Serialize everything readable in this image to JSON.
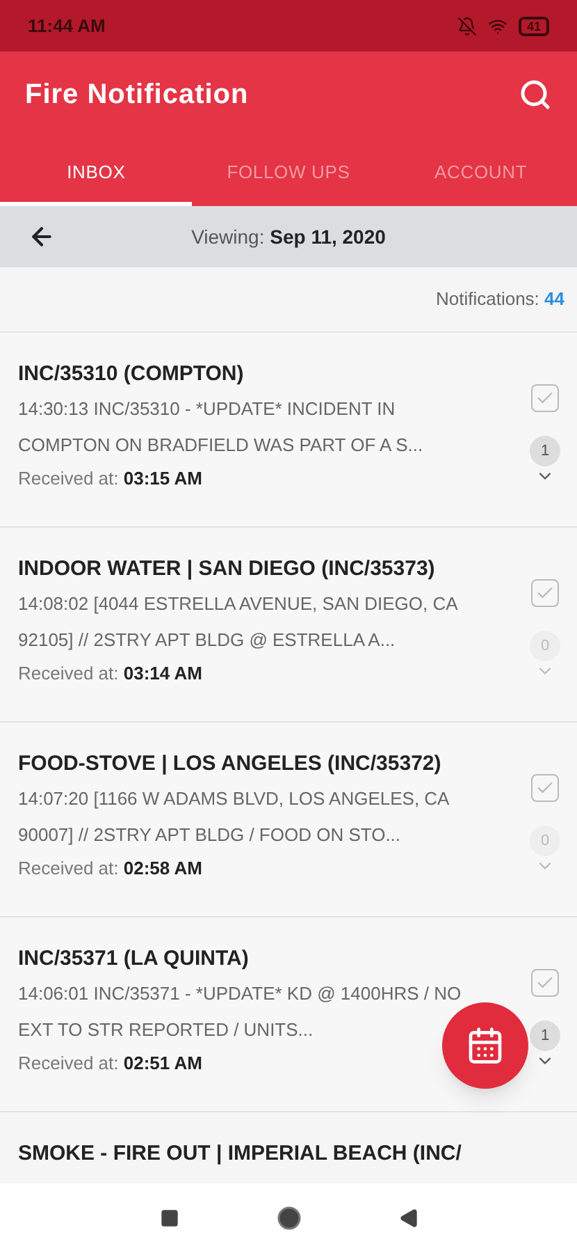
{
  "status_bar": {
    "time": "11:44 AM",
    "battery": "41"
  },
  "app_bar": {
    "title": "Fire Notification"
  },
  "tabs": [
    {
      "label": "INBOX",
      "selected": true
    },
    {
      "label": "FOLLOW UPS",
      "selected": false
    },
    {
      "label": "ACCOUNT",
      "selected": false
    }
  ],
  "date_bar": {
    "label": "Viewing:",
    "date": "Sep 11, 2020"
  },
  "summary": {
    "label": "Notifications:",
    "count": "44"
  },
  "notifications": [
    {
      "title": "INC/35310 (COMPTON)",
      "body": "14:30:13 INC/35310 - *UPDATE* INCIDENT IN COMPTON ON BRADFIELD WAS PART OF A S...",
      "received_label": "Received at:",
      "received_time": "03:15 AM",
      "count": "1",
      "checked": false
    },
    {
      "title": "INDOOR WATER | SAN DIEGO (INC/35373)",
      "body": "14:08:02 [4044 ESTRELLA AVENUE, SAN DIEGO, CA 92105]  // 2STRY APT BLDG @ ESTRELLA A...",
      "received_label": "Received at:",
      "received_time": "03:14 AM",
      "count": "0",
      "checked": false
    },
    {
      "title": "FOOD-STOVE | LOS ANGELES (INC/35372)",
      "body": "14:07:20 [1166 W ADAMS BLVD, LOS ANGELES, CA 90007]  // 2STRY APT BLDG / FOOD ON STO...",
      "received_label": "Received at:",
      "received_time": "02:58 AM",
      "count": "0",
      "checked": false
    },
    {
      "title": "INC/35371 (LA QUINTA)",
      "body": "14:06:01 INC/35371 - *UPDATE* KD @ 1400HRS / NO EXT TO STR REPORTED / UNITS...",
      "received_label": "Received at:",
      "received_time": "02:51 AM",
      "count": "1",
      "checked": false
    },
    {
      "title": "SMOKE - FIRE OUT | IMPERIAL BEACH (INC/"
    }
  ]
}
